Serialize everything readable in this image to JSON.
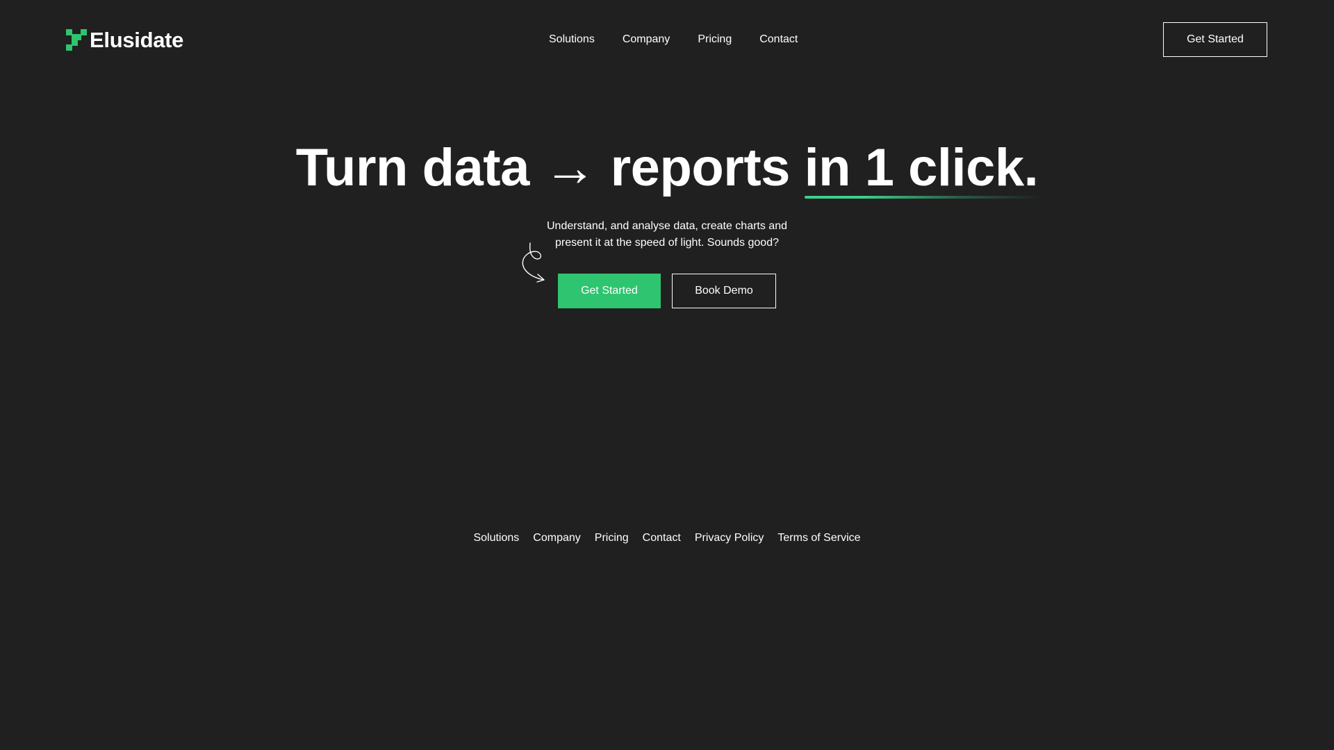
{
  "brand": {
    "name": "Elusidate",
    "logo_icon": "pixel-logo-icon",
    "accent_color": "#2fc46f",
    "background_color": "#202020"
  },
  "nav": {
    "items": [
      {
        "label": "Solutions"
      },
      {
        "label": "Company"
      },
      {
        "label": "Pricing"
      },
      {
        "label": "Contact"
      }
    ],
    "cta_label": "Get Started"
  },
  "hero": {
    "title_part1": "Turn data",
    "title_arrow": "→",
    "title_part2": "reports",
    "title_highlight": "in 1 click.",
    "subtitle": "Understand, and analyse data, create charts and present it at the speed of light. Sounds good?",
    "primary_button": "Get Started",
    "secondary_button": "Book Demo",
    "decoration_icon": "squiggle-arrow-icon"
  },
  "footer": {
    "links": [
      {
        "label": "Solutions"
      },
      {
        "label": "Company"
      },
      {
        "label": "Pricing"
      },
      {
        "label": "Contact"
      },
      {
        "label": "Privacy Policy"
      },
      {
        "label": "Terms of Service"
      }
    ]
  }
}
